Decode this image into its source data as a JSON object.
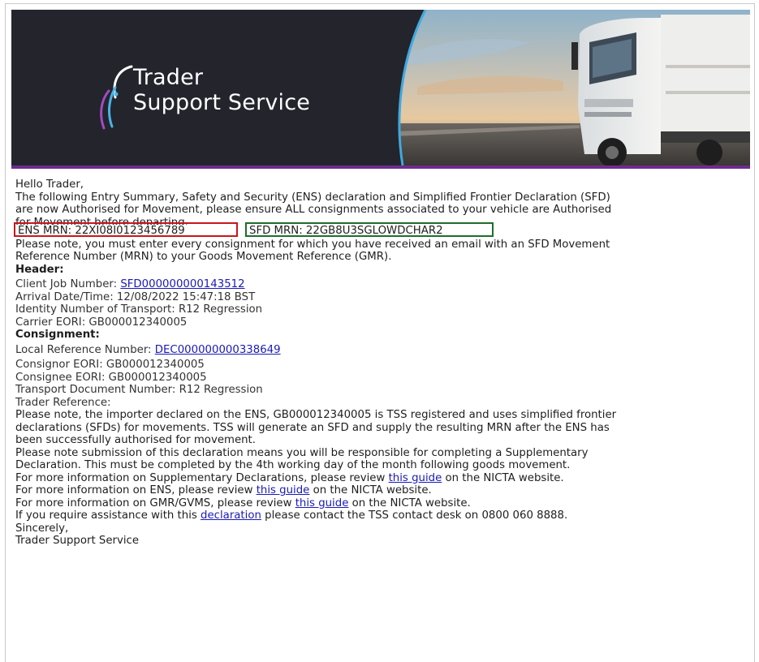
{
  "brand": {
    "logo_line1": "Trader",
    "logo_line2": "Support Service",
    "rule_color": "#6f2c91",
    "banner_image": "truck-on-road-photo"
  },
  "email": {
    "greeting": "Hello Trader,",
    "intro_line1": "The following Entry Summary, Safety and Security (ENS) declaration and Simplified Frontier Declaration (SFD)",
    "intro_line2": "are now Authorised for Movement, please ensure ALL consignments associated to your vehicle are Authorised",
    "intro_line3": "for Movement before departing.",
    "ens_mrn": "ENS MRN: 22XI08I0123456789",
    "ens_mrn_color": "#c8161d",
    "sfd_mrn": "SFD MRN: 22GB8U3SGLOWDCHAR2",
    "sfd_mrn_color": "#1f6e2b",
    "note_line1": "Please note, you must enter every consignment for which you have received an email with an SFD Movement",
    "note_line2": "Reference Number (MRN) to your Goods Movement Reference (GMR).",
    "header_heading": "Header:",
    "client_job_label": "Client Job Number: ",
    "client_job_value": "SFD000000000143512",
    "arrival": "Arrival Date/Time: 12/08/2022 15:47:18 BST",
    "identity_transport": "Identity Number of Transport: R12 Regression",
    "carrier_eori": "Carrier EORI: GB000012340005",
    "consignment_heading": "Consignment:",
    "lrn_label": "Local Reference Number: ",
    "lrn_value": "DEC000000000338649",
    "consignor_eori": "Consignor EORI: GB000012340005",
    "consignee_eori": "Consignee EORI: GB000012340005",
    "transport_doc": "Transport Document Number: R12 Regression",
    "trader_reference": "Trader Reference:",
    "importer_line1": "Please note, the importer declared on the ENS, GB000012340005 is TSS registered and uses simplified frontier",
    "importer_line2": "declarations (SFDs) for movements. TSS will generate an SFD and supply the resulting MRN after the ENS has",
    "importer_line3": "been successfully authorised for movement.",
    "submission_line1": "Please note submission of this declaration means you will be responsible for completing a Supplementary",
    "submission_line2": "Declaration. This must be completed by the 4th working day of the month following goods movement.",
    "supp_pre": "For more information on Supplementary Declarations, please review ",
    "supp_link": "this guide",
    "supp_post": " on the NICTA website.",
    "ens_pre": "For more information on ENS, please review ",
    "ens_link": "this guide",
    "ens_post": " on the NICTA website.",
    "gmr_pre": "For more information on GMR/GVMS, please review ",
    "gmr_link": "this guide",
    "gmr_post": " on the NICTA website.",
    "assist_pre": "If you require assistance with this ",
    "assist_link": "declaration",
    "assist_post": " please contact the TSS contact desk on 0800 060 8888.",
    "signoff": "Sincerely,",
    "signature": "Trader Support Service"
  }
}
